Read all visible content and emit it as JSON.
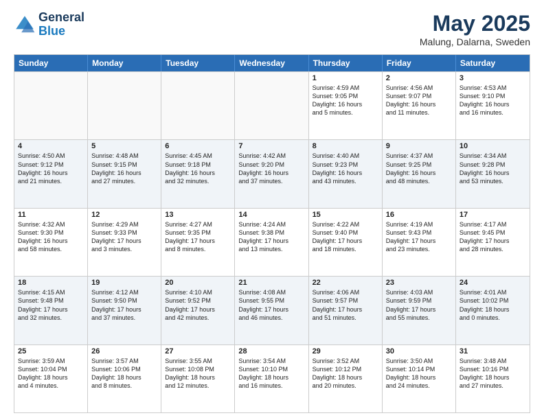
{
  "header": {
    "logo_line1": "General",
    "logo_line2": "Blue",
    "month": "May 2025",
    "location": "Malung, Dalarna, Sweden"
  },
  "weekdays": [
    "Sunday",
    "Monday",
    "Tuesday",
    "Wednesday",
    "Thursday",
    "Friday",
    "Saturday"
  ],
  "rows": [
    [
      {
        "day": "",
        "text": ""
      },
      {
        "day": "",
        "text": ""
      },
      {
        "day": "",
        "text": ""
      },
      {
        "day": "",
        "text": ""
      },
      {
        "day": "1",
        "text": "Sunrise: 4:59 AM\nSunset: 9:05 PM\nDaylight: 16 hours\nand 5 minutes."
      },
      {
        "day": "2",
        "text": "Sunrise: 4:56 AM\nSunset: 9:07 PM\nDaylight: 16 hours\nand 11 minutes."
      },
      {
        "day": "3",
        "text": "Sunrise: 4:53 AM\nSunset: 9:10 PM\nDaylight: 16 hours\nand 16 minutes."
      }
    ],
    [
      {
        "day": "4",
        "text": "Sunrise: 4:50 AM\nSunset: 9:12 PM\nDaylight: 16 hours\nand 21 minutes."
      },
      {
        "day": "5",
        "text": "Sunrise: 4:48 AM\nSunset: 9:15 PM\nDaylight: 16 hours\nand 27 minutes."
      },
      {
        "day": "6",
        "text": "Sunrise: 4:45 AM\nSunset: 9:18 PM\nDaylight: 16 hours\nand 32 minutes."
      },
      {
        "day": "7",
        "text": "Sunrise: 4:42 AM\nSunset: 9:20 PM\nDaylight: 16 hours\nand 37 minutes."
      },
      {
        "day": "8",
        "text": "Sunrise: 4:40 AM\nSunset: 9:23 PM\nDaylight: 16 hours\nand 43 minutes."
      },
      {
        "day": "9",
        "text": "Sunrise: 4:37 AM\nSunset: 9:25 PM\nDaylight: 16 hours\nand 48 minutes."
      },
      {
        "day": "10",
        "text": "Sunrise: 4:34 AM\nSunset: 9:28 PM\nDaylight: 16 hours\nand 53 minutes."
      }
    ],
    [
      {
        "day": "11",
        "text": "Sunrise: 4:32 AM\nSunset: 9:30 PM\nDaylight: 16 hours\nand 58 minutes."
      },
      {
        "day": "12",
        "text": "Sunrise: 4:29 AM\nSunset: 9:33 PM\nDaylight: 17 hours\nand 3 minutes."
      },
      {
        "day": "13",
        "text": "Sunrise: 4:27 AM\nSunset: 9:35 PM\nDaylight: 17 hours\nand 8 minutes."
      },
      {
        "day": "14",
        "text": "Sunrise: 4:24 AM\nSunset: 9:38 PM\nDaylight: 17 hours\nand 13 minutes."
      },
      {
        "day": "15",
        "text": "Sunrise: 4:22 AM\nSunset: 9:40 PM\nDaylight: 17 hours\nand 18 minutes."
      },
      {
        "day": "16",
        "text": "Sunrise: 4:19 AM\nSunset: 9:43 PM\nDaylight: 17 hours\nand 23 minutes."
      },
      {
        "day": "17",
        "text": "Sunrise: 4:17 AM\nSunset: 9:45 PM\nDaylight: 17 hours\nand 28 minutes."
      }
    ],
    [
      {
        "day": "18",
        "text": "Sunrise: 4:15 AM\nSunset: 9:48 PM\nDaylight: 17 hours\nand 32 minutes."
      },
      {
        "day": "19",
        "text": "Sunrise: 4:12 AM\nSunset: 9:50 PM\nDaylight: 17 hours\nand 37 minutes."
      },
      {
        "day": "20",
        "text": "Sunrise: 4:10 AM\nSunset: 9:52 PM\nDaylight: 17 hours\nand 42 minutes."
      },
      {
        "day": "21",
        "text": "Sunrise: 4:08 AM\nSunset: 9:55 PM\nDaylight: 17 hours\nand 46 minutes."
      },
      {
        "day": "22",
        "text": "Sunrise: 4:06 AM\nSunset: 9:57 PM\nDaylight: 17 hours\nand 51 minutes."
      },
      {
        "day": "23",
        "text": "Sunrise: 4:03 AM\nSunset: 9:59 PM\nDaylight: 17 hours\nand 55 minutes."
      },
      {
        "day": "24",
        "text": "Sunrise: 4:01 AM\nSunset: 10:02 PM\nDaylight: 18 hours\nand 0 minutes."
      }
    ],
    [
      {
        "day": "25",
        "text": "Sunrise: 3:59 AM\nSunset: 10:04 PM\nDaylight: 18 hours\nand 4 minutes."
      },
      {
        "day": "26",
        "text": "Sunrise: 3:57 AM\nSunset: 10:06 PM\nDaylight: 18 hours\nand 8 minutes."
      },
      {
        "day": "27",
        "text": "Sunrise: 3:55 AM\nSunset: 10:08 PM\nDaylight: 18 hours\nand 12 minutes."
      },
      {
        "day": "28",
        "text": "Sunrise: 3:54 AM\nSunset: 10:10 PM\nDaylight: 18 hours\nand 16 minutes."
      },
      {
        "day": "29",
        "text": "Sunrise: 3:52 AM\nSunset: 10:12 PM\nDaylight: 18 hours\nand 20 minutes."
      },
      {
        "day": "30",
        "text": "Sunrise: 3:50 AM\nSunset: 10:14 PM\nDaylight: 18 hours\nand 24 minutes."
      },
      {
        "day": "31",
        "text": "Sunrise: 3:48 AM\nSunset: 10:16 PM\nDaylight: 18 hours\nand 27 minutes."
      }
    ]
  ]
}
